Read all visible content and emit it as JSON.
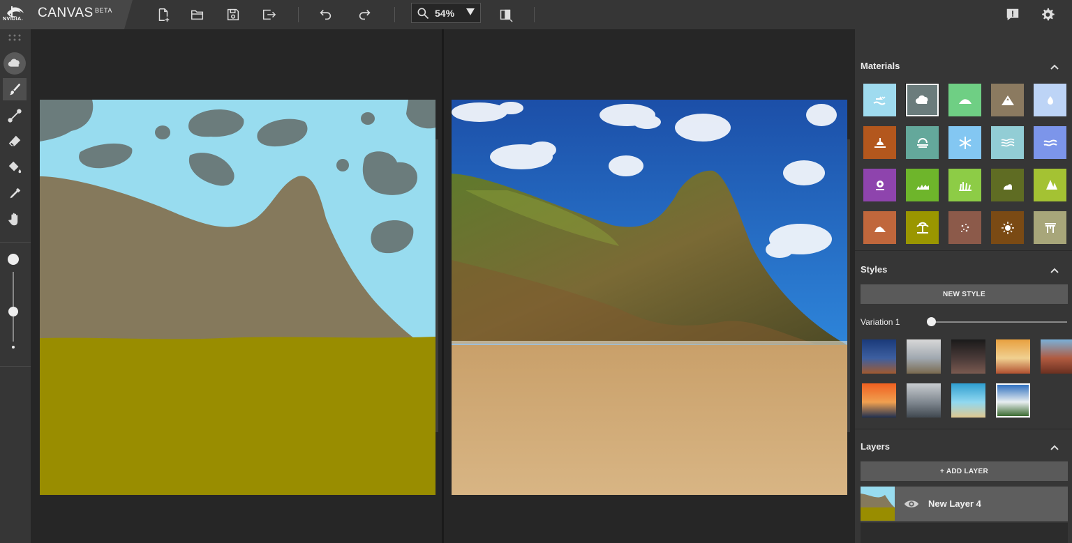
{
  "brand": {
    "logo_text": "NVIDIA.",
    "title": "CANVAS",
    "badge": "BETA"
  },
  "toolbar": {
    "icons": [
      "new-file-icon",
      "open-folder-icon",
      "save-icon",
      "export-icon",
      "undo-icon",
      "redo-icon",
      "compare-view-icon",
      "notification-icon",
      "gear-icon"
    ],
    "zoom": "54%"
  },
  "tools": [
    "material-fill-tool",
    "brush-tool",
    "line-tool",
    "eraser-tool",
    "paint-bucket-tool",
    "eyedropper-tool",
    "pan-hand-tool"
  ],
  "brush_size_level": 0.57,
  "panels": {
    "materials": {
      "title": "Materials",
      "items": [
        {
          "name": "sea",
          "color": "#9fdbef",
          "icon": "waves-birds-icon",
          "selected": false
        },
        {
          "name": "cloud",
          "color": "#6b7c7c",
          "icon": "cloud-icon",
          "selected": true
        },
        {
          "name": "hill",
          "color": "#6fcf84",
          "icon": "hill-icon",
          "selected": false
        },
        {
          "name": "mountain",
          "color": "#8b7a60",
          "icon": "mountain-icon",
          "selected": false
        },
        {
          "name": "water",
          "color": "#bdd4f6",
          "icon": "droplet-icon",
          "selected": false
        },
        {
          "name": "sand-sunset",
          "color": "#b3571d",
          "icon": "sunset-icon",
          "selected": false
        },
        {
          "name": "fog",
          "color": "#64a89b",
          "icon": "fog-icon",
          "selected": false
        },
        {
          "name": "snow",
          "color": "#83c7f2",
          "icon": "snowflake-icon",
          "selected": false
        },
        {
          "name": "river",
          "color": "#92cdd5",
          "icon": "river-icon",
          "selected": false
        },
        {
          "name": "sea-wave",
          "color": "#7c95ea",
          "icon": "wave-icon",
          "selected": false
        },
        {
          "name": "flower",
          "color": "#8e44ad",
          "icon": "flower-icon",
          "selected": false
        },
        {
          "name": "grass",
          "color": "#6eb52b",
          "icon": "grass-field-icon",
          "selected": false
        },
        {
          "name": "tall-grass",
          "color": "#8dcc46",
          "icon": "tall-grass-icon",
          "selected": false
        },
        {
          "name": "dirt",
          "color": "#5f6c23",
          "icon": "bush-icon",
          "selected": false
        },
        {
          "name": "tree",
          "color": "#a4c233",
          "icon": "tree-icon",
          "selected": false
        },
        {
          "name": "rock",
          "color": "#c0673c",
          "icon": "rock-icon",
          "selected": false
        },
        {
          "name": "beach",
          "color": "#9a9600",
          "icon": "palm-icon",
          "selected": false
        },
        {
          "name": "gravel",
          "color": "#8c5a4a",
          "icon": "gravel-icon",
          "selected": false
        },
        {
          "name": "stone",
          "color": "#7a4a14",
          "icon": "stone-burst-icon",
          "selected": false
        },
        {
          "name": "structure",
          "color": "#a8a67a",
          "icon": "gate-icon",
          "selected": false
        }
      ]
    },
    "styles": {
      "title": "Styles",
      "new_style_label": "NEW STYLE",
      "variation_label": "Variation 1",
      "variation_value": 0,
      "thumbs": [
        {
          "name": "style-desert-night",
          "colors": [
            "#1a3a7a",
            "#3d5fa0",
            "#a05a30"
          ],
          "selected": false
        },
        {
          "name": "style-cloudy-mountain",
          "colors": [
            "#d8d8d8",
            "#a0a8b0",
            "#7a6a50"
          ],
          "selected": false
        },
        {
          "name": "style-dark-arch",
          "colors": [
            "#1a1a1a",
            "#4a3a38",
            "#7a5a50"
          ],
          "selected": false
        },
        {
          "name": "style-sunset-clouds",
          "colors": [
            "#e8a040",
            "#f0d090",
            "#b05030"
          ],
          "selected": false
        },
        {
          "name": "style-red-cliffs",
          "colors": [
            "#7ab0d8",
            "#b05a40",
            "#6a3020"
          ],
          "selected": false
        },
        {
          "name": "style-ocean-sunset",
          "colors": [
            "#f06020",
            "#f0a050",
            "#203050"
          ],
          "selected": false
        },
        {
          "name": "style-misty-peaks",
          "colors": [
            "#c8ccd0",
            "#808890",
            "#404850"
          ],
          "selected": false
        },
        {
          "name": "style-tropical-beach",
          "colors": [
            "#2f9ed0",
            "#90d8f0",
            "#e0c890"
          ],
          "selected": false
        },
        {
          "name": "style-alpine-lake",
          "colors": [
            "#3070c0",
            "#e8eef0",
            "#3a6a30"
          ],
          "selected": true
        }
      ]
    },
    "layers": {
      "title": "Layers",
      "add_label": "+ ADD LAYER",
      "items": [
        {
          "name": "New Layer 4",
          "visible": true
        }
      ]
    }
  }
}
